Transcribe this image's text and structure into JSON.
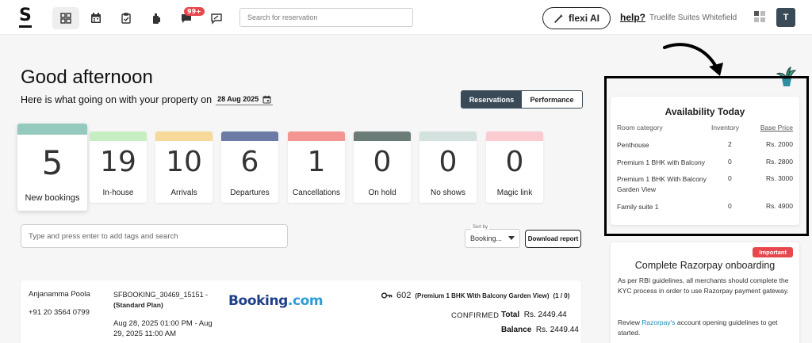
{
  "brand": {
    "logo": "S"
  },
  "header": {
    "notification_badge": "99+",
    "search_placeholder": "Search for reservation",
    "flexi_label": "flexi AI",
    "help_label": "help?",
    "property_name": "Truelife Suites Whitefield",
    "avatar_initial": "T"
  },
  "greeting": {
    "title": "Good afternoon",
    "subtitle": "Here is what going on with your property on",
    "date": "28 Aug 2025"
  },
  "view_toggle": {
    "active": "Reservations",
    "inactive": "Performance"
  },
  "stats": [
    {
      "value": "5",
      "label": "New bookings",
      "color": "#94c9be"
    },
    {
      "value": "19",
      "label": "In-house",
      "color": "#c7eec2"
    },
    {
      "value": "10",
      "label": "Arrivals",
      "color": "#f7d99a"
    },
    {
      "value": "6",
      "label": "Departures",
      "color": "#6b7ba6"
    },
    {
      "value": "1",
      "label": "Cancellations",
      "color": "#f39591"
    },
    {
      "value": "0",
      "label": "On hold",
      "color": "#6b7b78"
    },
    {
      "value": "0",
      "label": "No shows",
      "color": "#d3e2df"
    },
    {
      "value": "0",
      "label": "Magic link",
      "color": "#fbcbd2"
    }
  ],
  "filters": {
    "tag_placeholder": "Type and press enter to add tags and search",
    "sort_label": "Sort by",
    "sort_value": "Booking...",
    "download_label": "Download report"
  },
  "reservation": {
    "guest": "Anjanamma Poola",
    "phone": "+91 20 3564 0799",
    "booking_id": "SFBOOKING_30469_15151 -",
    "plan": "(Standard Plan)",
    "dates": "Aug 28, 2025 01:00 PM - Aug 29, 2025 11:00 AM",
    "channel_main": "Booking",
    "channel_suffix": ".com",
    "room_no": "602",
    "room_desc": "(Premium 1 BHK With Balcony Garden View)",
    "room_count": "(1 / 0)",
    "status": "CONFIRMED",
    "total_label": "Total",
    "total_value": "Rs. 2449.44",
    "balance_label": "Balance",
    "balance_value": "Rs. 2449.44"
  },
  "availability": {
    "title": "Availability Today",
    "col_category": "Room category",
    "col_inventory": "Inventory",
    "col_price": "Base Price",
    "rows": [
      {
        "category": "Penthouse",
        "inventory": "2",
        "price": "Rs. 2000"
      },
      {
        "category": "Premium 1 BHK with Balcony",
        "inventory": "0",
        "price": "Rs. 2800"
      },
      {
        "category": "Premium 1 BHK With Balcony Garden View",
        "inventory": "0",
        "price": "Rs. 3000"
      },
      {
        "category": "Family suite 1",
        "inventory": "0",
        "price": "Rs. 4900"
      }
    ]
  },
  "razorpay": {
    "badge": "Important",
    "title": "Complete Razorpay onboarding",
    "body": "As per RBI guidelines, all merchants should complete the KYC process in order to use Razorpay payment gateway.",
    "review_prefix": "Review",
    "review_link": "Razorpay's",
    "review_suffix": "account opening guidelines to get started."
  }
}
